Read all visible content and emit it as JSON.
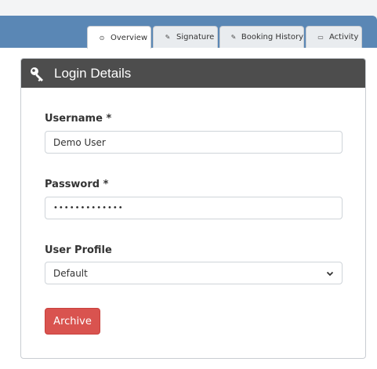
{
  "tabs": [
    {
      "label": "Overview",
      "icon": "circle-dot-icon",
      "active": true
    },
    {
      "label": "Signature",
      "icon": "edit-icon",
      "active": false
    },
    {
      "label": "Booking History",
      "icon": "edit-icon",
      "active": false
    },
    {
      "label": "Activity",
      "icon": "inbox-icon",
      "active": false
    }
  ],
  "panel": {
    "title": "Login Details",
    "icon": "key-icon"
  },
  "form": {
    "username_label": "Username *",
    "username_value": "Demo User",
    "password_label": "Password *",
    "password_value": "•••••••••••••",
    "profile_label": "User Profile",
    "profile_selected": "Default"
  },
  "actions": {
    "archive_label": "Archive"
  },
  "colors": {
    "header_band": "#5a87b5",
    "panel_header": "#4d4d4d",
    "archive_button": "#d9534f"
  }
}
